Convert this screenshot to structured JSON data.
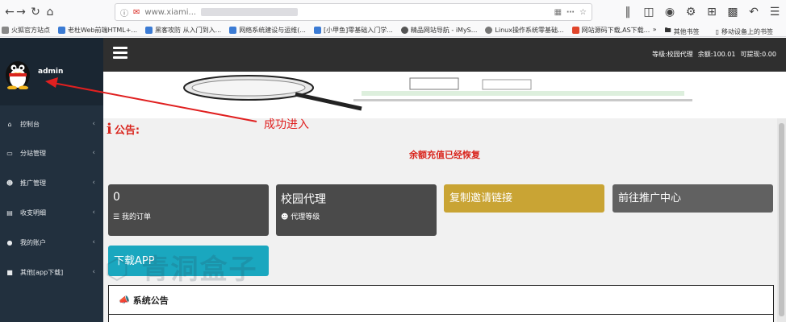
{
  "browser": {
    "url": "www.xiami...",
    "bookmarks": [
      "火狐官方站点",
      "老杜Web前端HTML+...",
      "黑客攻防 从入门到入...",
      "网络系统建设与运维(...",
      "[小甲鱼]零基础入门学...",
      "精品网站导航 - iMyS...",
      "Linux操作系统零基础...",
      "网站源码下载,AS下载..."
    ],
    "bookmarks_right": [
      "其他书签",
      "移动设备上的书签"
    ]
  },
  "sidebar": {
    "username": "admin",
    "items": [
      {
        "label": "控制台",
        "icon": "home-icon"
      },
      {
        "label": "分站管理",
        "icon": "monitor-icon"
      },
      {
        "label": "推广管理",
        "icon": "users-icon"
      },
      {
        "label": "收支明细",
        "icon": "bar-chart-icon"
      },
      {
        "label": "我的账户",
        "icon": "user-icon"
      },
      {
        "label": "其他[app下载]",
        "icon": "folder-icon"
      }
    ]
  },
  "navbar": {
    "level": "等级:校园代理",
    "balance": "余额:100.01",
    "withdrawable": "可提现:0.00"
  },
  "notice": {
    "title": "公告:",
    "message": "余额充值已经恢复"
  },
  "cards": {
    "orders_count": "0",
    "orders_label": "我的订单",
    "agent_title": "校园代理",
    "agent_label": "代理等级",
    "copy_invite": "复制邀请链接",
    "goto_promo": "前往推广中心",
    "download_app": "下载APP"
  },
  "system_notice": {
    "title": "系统公告"
  },
  "annotation": {
    "text": "成功进入"
  },
  "colors": {
    "sidebar": "#22303e",
    "navbar": "#2f2f2f",
    "card_dark": "#4a4a4a",
    "card_gold": "#c9a434",
    "card_gray": "#616161",
    "card_teal": "#1aa7bf",
    "accent_red": "#d9241c"
  }
}
